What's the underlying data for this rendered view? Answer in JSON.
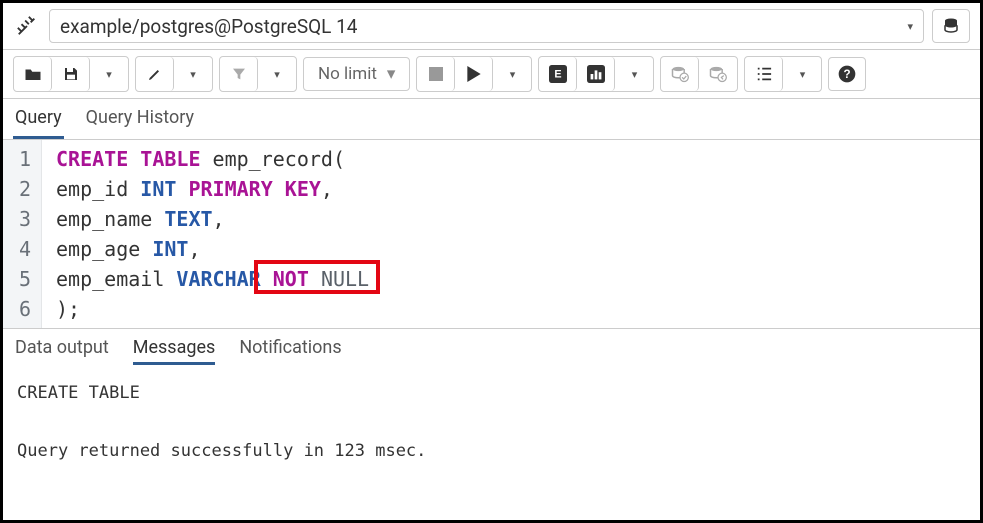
{
  "connection": {
    "label": "example/postgres@PostgreSQL 14"
  },
  "toolbar": {
    "limit_label": "No limit"
  },
  "tabs": {
    "query": "Query",
    "history": "Query History"
  },
  "code": {
    "lines": [
      {
        "n": 1,
        "segments": [
          {
            "t": "CREATE TABLE",
            "c": "kw-purple"
          },
          {
            "t": " emp_record(",
            "c": ""
          }
        ]
      },
      {
        "n": 2,
        "segments": [
          {
            "t": "emp_id ",
            "c": ""
          },
          {
            "t": "INT",
            "c": "kw-blue"
          },
          {
            "t": " ",
            "c": ""
          },
          {
            "t": "PRIMARY KEY",
            "c": "kw-purple"
          },
          {
            "t": ",",
            "c": ""
          }
        ]
      },
      {
        "n": 3,
        "segments": [
          {
            "t": "emp_name ",
            "c": ""
          },
          {
            "t": "TEXT",
            "c": "kw-blue"
          },
          {
            "t": ",",
            "c": ""
          }
        ]
      },
      {
        "n": 4,
        "segments": [
          {
            "t": "emp_age ",
            "c": ""
          },
          {
            "t": "INT",
            "c": "kw-blue"
          },
          {
            "t": ",",
            "c": ""
          }
        ]
      },
      {
        "n": 5,
        "segments": [
          {
            "t": "emp_email ",
            "c": ""
          },
          {
            "t": "VARCHAR",
            "c": "kw-blue"
          },
          {
            "t": " ",
            "c": ""
          },
          {
            "t": "NOT",
            "c": "kw-purple"
          },
          {
            "t": " ",
            "c": ""
          },
          {
            "t": "NULL",
            "c": "kw-grey"
          }
        ]
      },
      {
        "n": 6,
        "segments": [
          {
            "t": ");",
            "c": ""
          }
        ]
      }
    ]
  },
  "output_tabs": {
    "data": "Data output",
    "messages": "Messages",
    "notifications": "Notifications"
  },
  "messages": {
    "line1": "CREATE TABLE",
    "line2": "Query returned successfully in 123 msec."
  }
}
